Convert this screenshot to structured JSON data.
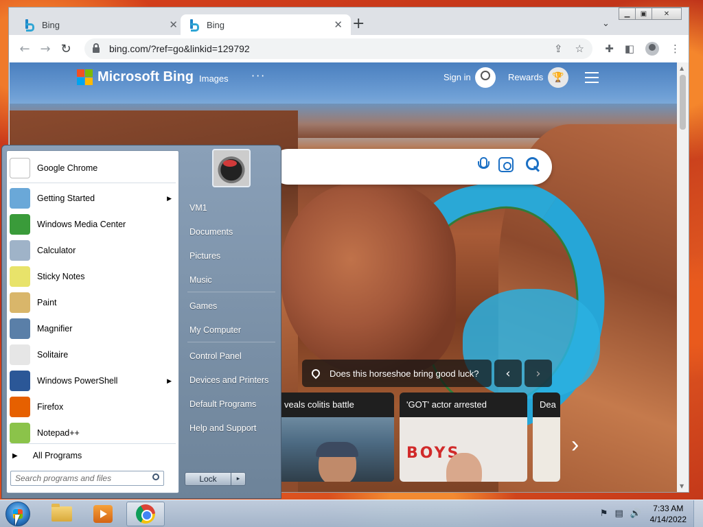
{
  "browser": {
    "tabs": [
      {
        "title": "Bing",
        "active": false
      },
      {
        "title": "Bing",
        "active": true
      }
    ],
    "new_tab_icon": "plus-icon",
    "url": "bing.com/?ref=go&linkid=129792"
  },
  "bing": {
    "brand": "Microsoft Bing",
    "nav": {
      "images": "Images",
      "more": "···"
    },
    "sign_in": "Sign in",
    "rewards": "Rewards",
    "quiz": "Does this horseshoe bring good luck?",
    "prev_label": "‹",
    "next_label": "›",
    "news_next": "›",
    "news": [
      {
        "title": "veals colitis battle"
      },
      {
        "title": "'GOT' actor arrested"
      },
      {
        "title": "Dea"
      }
    ],
    "card2_graffiti": "BOYS",
    "logo_colors": [
      "#f25022",
      "#7fba00",
      "#00a4ef",
      "#ffb900"
    ]
  },
  "start_menu": {
    "pinned": [
      {
        "label": "Google Chrome",
        "icon": "document-icon",
        "color": "#ffffff"
      }
    ],
    "programs": [
      {
        "label": "Getting Started",
        "icon": "getting-started-icon",
        "color": "#6aa8d8",
        "submenu": true
      },
      {
        "label": "Windows Media Center",
        "icon": "media-center-icon",
        "color": "#3a9b3a",
        "submenu": false
      },
      {
        "label": "Calculator",
        "icon": "calculator-icon",
        "color": "#9fb3c8",
        "submenu": false
      },
      {
        "label": "Sticky Notes",
        "icon": "sticky-notes-icon",
        "color": "#e8e36a",
        "submenu": false
      },
      {
        "label": "Paint",
        "icon": "paint-icon",
        "color": "#d9b66a",
        "submenu": false
      },
      {
        "label": "Magnifier",
        "icon": "magnifier-icon",
        "color": "#5a7fa8",
        "submenu": false
      },
      {
        "label": "Solitaire",
        "icon": "solitaire-icon",
        "color": "#e6e6e6",
        "submenu": false
      },
      {
        "label": "Windows PowerShell",
        "icon": "powershell-icon",
        "color": "#2b5797",
        "submenu": true
      },
      {
        "label": "Firefox",
        "icon": "firefox-icon",
        "color": "#e66000",
        "submenu": false
      },
      {
        "label": "Notepad++",
        "icon": "notepadpp-icon",
        "color": "#8bc34a",
        "submenu": false
      }
    ],
    "all_programs": "All Programs",
    "search_placeholder": "Search programs and files",
    "right_items": [
      {
        "label": "VM1"
      },
      {
        "label": "Documents"
      },
      {
        "label": "Pictures"
      },
      {
        "label": "Music"
      },
      {
        "label": "Games"
      },
      {
        "label": "My Computer"
      },
      {
        "label": "Control Panel"
      },
      {
        "label": "Devices and Printers"
      },
      {
        "label": "Default Programs"
      },
      {
        "label": "Help and Support"
      }
    ],
    "lock_label": "Lock",
    "lock_arrow": "▸"
  },
  "taskbar": {
    "time": "7:33 AM",
    "date": "4/14/2022"
  }
}
